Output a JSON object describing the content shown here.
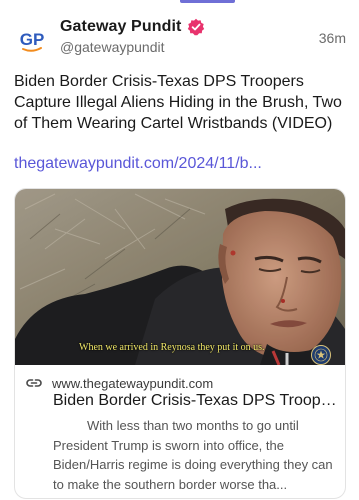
{
  "post": {
    "author_name": "Gateway Pundit",
    "author_handle": "@gatewaypundit",
    "avatar_text": "GP",
    "time": "36m",
    "text": "Biden Border Crisis-Texas DPS Troopers Capture Illegal Aliens Hiding in the Brush, Two of Them Wearing Cartel Wristbands (VIDEO)",
    "link_text": "thegatewaypundit.com/2024/11/b..."
  },
  "card": {
    "video_caption": "When we arrived in Reynosa they put it on us.",
    "domain": "www.thegatewaypundit.com",
    "title": "Biden Border Crisis-Texas DPS Troopers Capture Illegal Aliens Hiding in the Brush, Two of Them Wearing Cartel Wristbands (VIDEO)",
    "description": "With less than two months to go until President Trump is sworn into office, the Biden/Harris regime is doing everything they can to make the southern border worse tha..."
  },
  "colors": {
    "link": "#5a57d8",
    "avatar_blue": "#2e5bbd",
    "avatar_orange": "#f28c1e",
    "verified_badge": "#e8336d"
  },
  "icons": {
    "verified": "verified-badge-icon",
    "link": "link-chain-icon",
    "seal": "dps-seal-icon"
  }
}
